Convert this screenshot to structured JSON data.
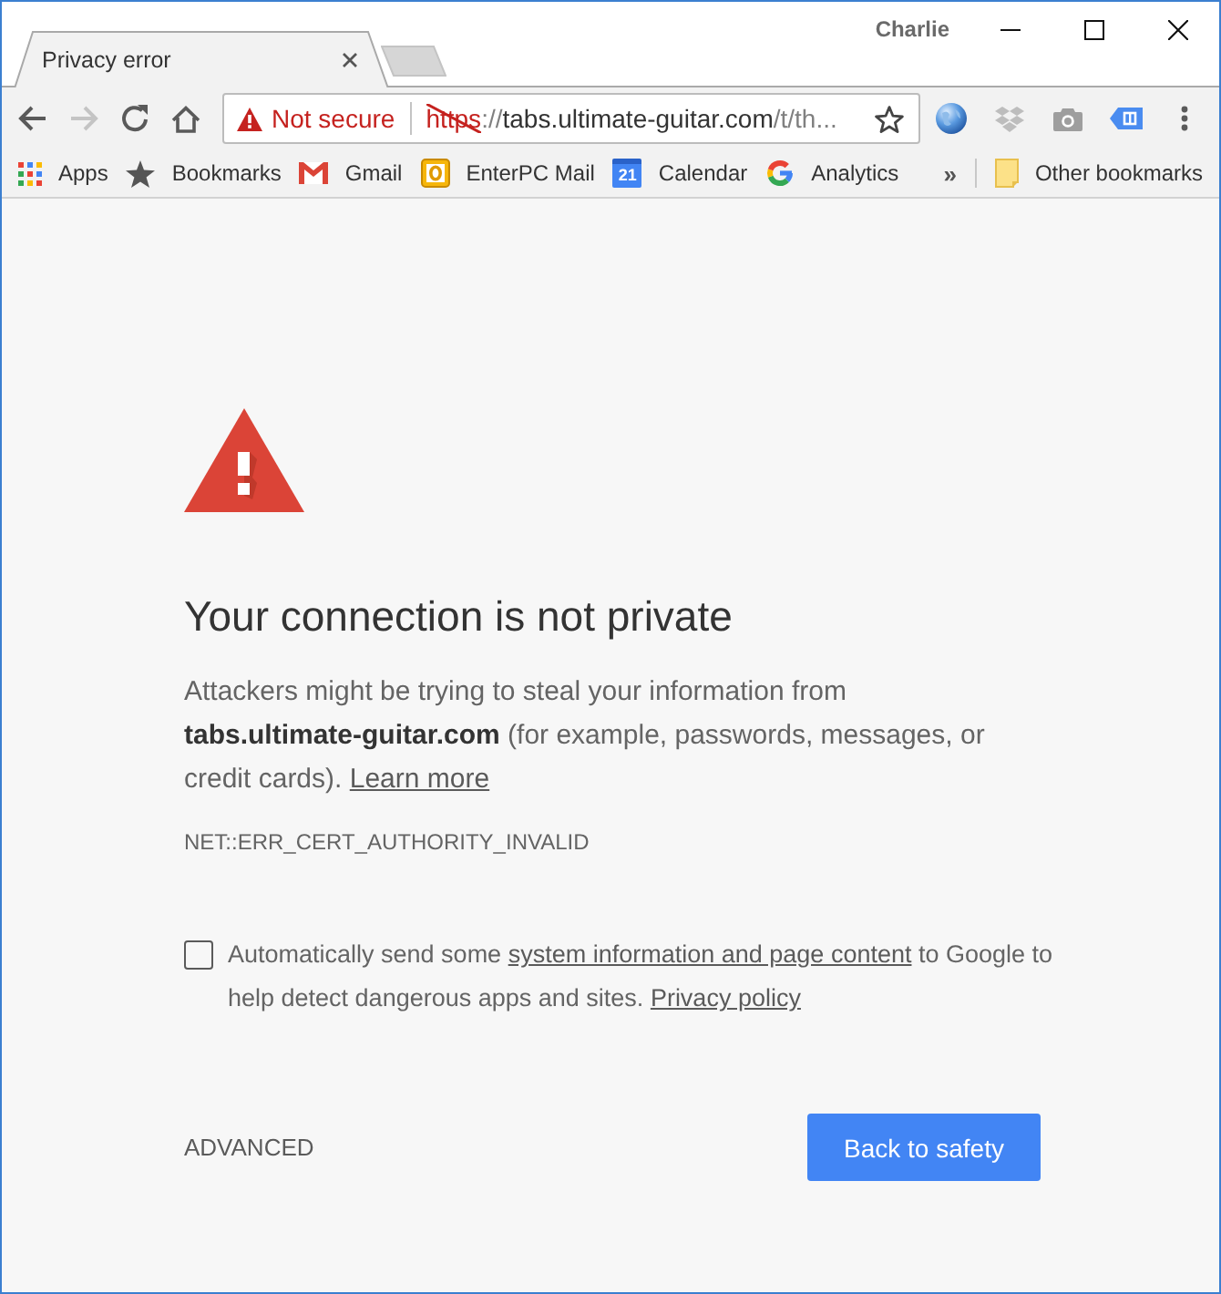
{
  "window": {
    "profile_name": "Charlie"
  },
  "tabs": [
    {
      "title": "Privacy error",
      "selected": true
    }
  ],
  "toolbar": {
    "back_disabled": false,
    "forward_disabled": true,
    "security": {
      "secure": false,
      "label": "Not secure"
    },
    "url": {
      "scheme": "https",
      "scheme_struck": true,
      "separator": "://",
      "host": "tabs.ultimate-guitar.com",
      "path": "/t/th..."
    },
    "bookmarked": false
  },
  "bookmarks_bar": {
    "items": [
      {
        "kind": "apps",
        "label": "Apps"
      },
      {
        "kind": "star",
        "label": "Bookmarks"
      },
      {
        "kind": "gmail",
        "label": "Gmail"
      },
      {
        "kind": "mail",
        "label": "EnterPC Mail"
      },
      {
        "kind": "calendar",
        "label": "Calendar",
        "icon_text": "21"
      },
      {
        "kind": "google",
        "label": "Analytics"
      }
    ],
    "overflow": "»",
    "other": {
      "kind": "folder",
      "label": "Other bookmarks"
    }
  },
  "error_page": {
    "heading": "Your connection is not private",
    "message": "Attackers might be trying to steal your information from **tabs.ultimate-guitar.com** (for example, passwords, messages, or credit cards).",
    "learn_more": "Learn more",
    "code": "NET::ERR_CERT_AUTHORITY_INVALID",
    "consent": {
      "checked": false,
      "text_before": "Automatically send some",
      "link": "system information and page content",
      "text_after": "to Google to help detect dangerous apps and sites.",
      "policy_link": "Privacy policy"
    },
    "advanced": "ADVANCED",
    "primary_button": "Back to safety"
  }
}
